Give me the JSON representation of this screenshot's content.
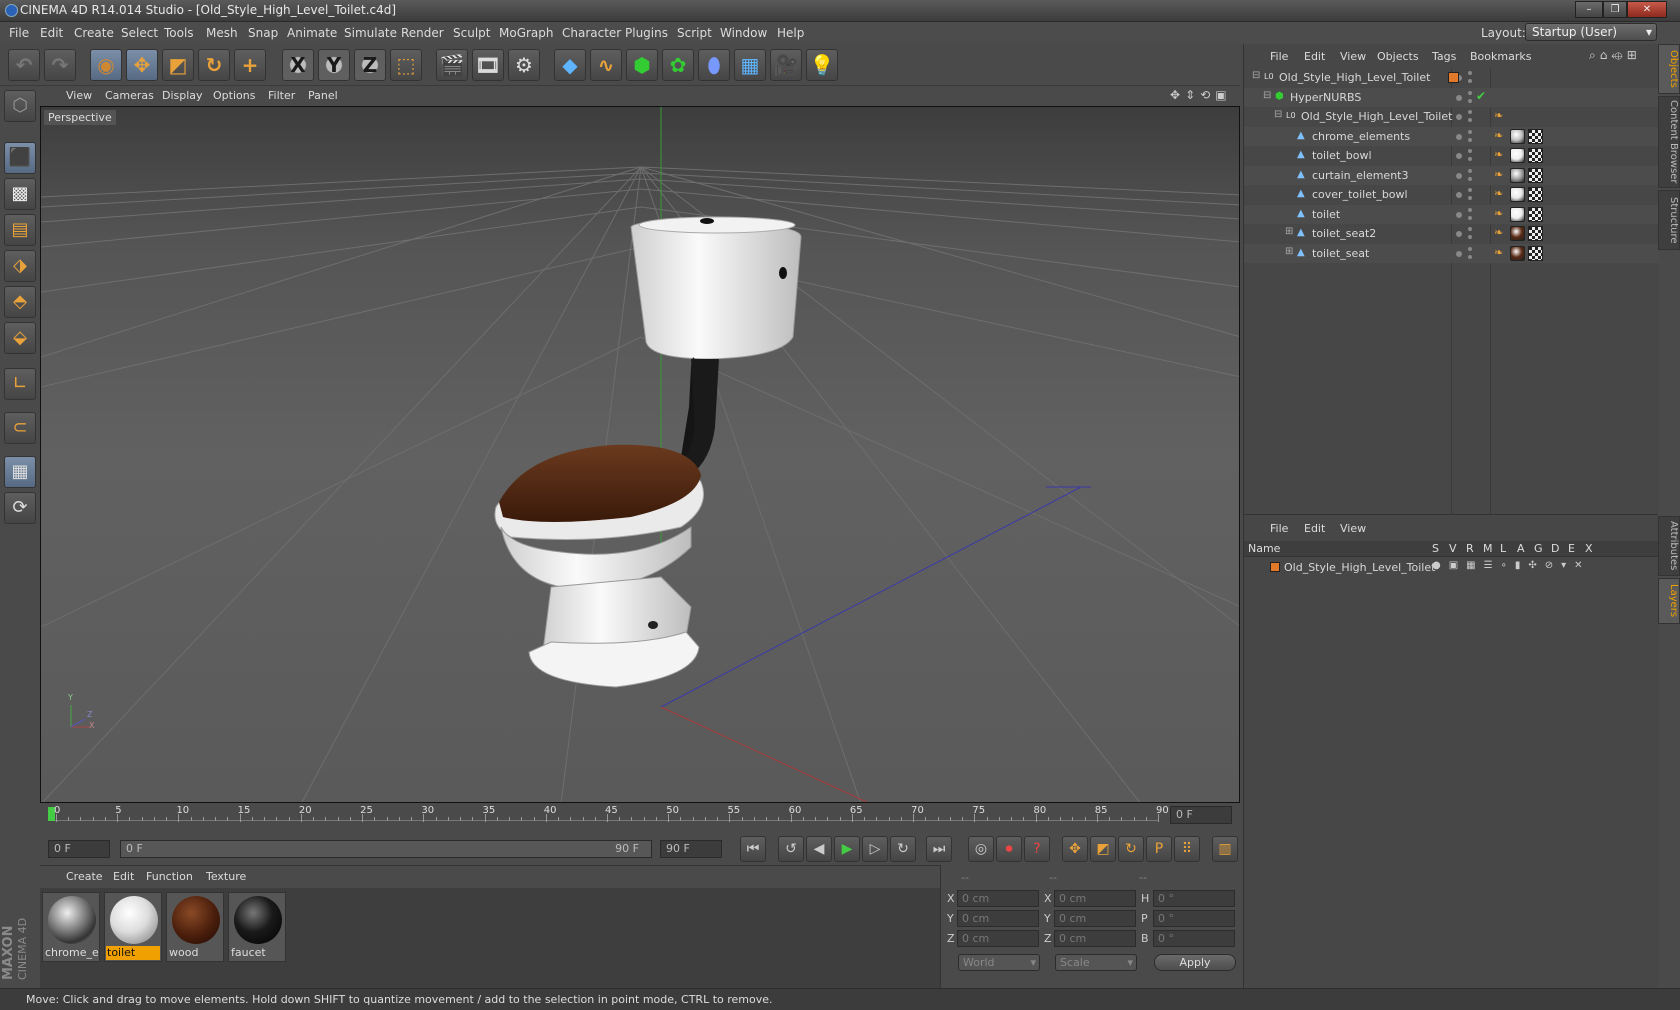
{
  "window": {
    "title": "CINEMA 4D R14.014 Studio - [Old_Style_High_Level_Toilet.c4d]",
    "controls": [
      "–",
      "❐",
      "✕"
    ]
  },
  "menubar": {
    "items": [
      "File",
      "Edit",
      "Create",
      "Select",
      "Tools",
      "Mesh",
      "Snap",
      "Animate",
      "Simulate",
      "Render",
      "Sculpt",
      "MoGraph",
      "Character",
      "Plugins",
      "Script",
      "Window",
      "Help"
    ],
    "layout_label": "Layout:",
    "layout_value": "Startup (User)"
  },
  "toolbar": {
    "icons": [
      "undo-icon",
      "redo-icon",
      "live-selection-icon",
      "move-icon",
      "scale-icon",
      "rotate-icon",
      "add-icon",
      "x-axis-icon",
      "y-axis-icon",
      "z-axis-icon",
      "coordinate-system-icon",
      "render-view-icon",
      "render-picture-viewer-icon",
      "render-settings-icon",
      "cube-primitive-icon",
      "spline-icon",
      "nurbs-icon",
      "array-icon",
      "deformer-icon",
      "floor-icon",
      "camera-icon",
      "light-icon"
    ],
    "axis_labels": [
      "X",
      "Y",
      "Z"
    ]
  },
  "lefttools": {
    "icons": [
      "make-editable-icon",
      "model-mode-icon",
      "texture-mode-icon",
      "workplane-icon",
      "points-mode-icon",
      "edges-mode-icon",
      "polygons-mode-icon",
      "axis-mode-icon",
      "tweak-mode-icon",
      "snap-grid-icon",
      "lock-workplane-icon"
    ]
  },
  "viewport": {
    "menu": [
      "View",
      "Cameras",
      "Display",
      "Options",
      "Filter",
      "Panel"
    ],
    "label": "Perspective",
    "nav_icons": [
      "move-view-icon",
      "zoom-view-icon",
      "rotate-view-icon",
      "maximize-view-icon"
    ],
    "axis_gizmo": {
      "y": "Y",
      "x": "X",
      "z": "Z"
    }
  },
  "timeline": {
    "ticks": [
      "0",
      "5",
      "10",
      "15",
      "20",
      "25",
      "30",
      "35",
      "40",
      "45",
      "50",
      "55",
      "60",
      "65",
      "70",
      "75",
      "80",
      "85",
      "90"
    ],
    "current_frame": "0 F",
    "frame_field": "0 F",
    "range_start": "0 F",
    "range_end": "90 F",
    "end_field": "90 F"
  },
  "materials": {
    "menu": [
      "Create",
      "Edit",
      "Function",
      "Texture"
    ],
    "items": [
      {
        "label": "chrome_ele",
        "color": "#a8a8a8"
      },
      {
        "label": "toilet",
        "color": "#eeeeee"
      },
      {
        "label": "wood",
        "color": "#5a2a14"
      },
      {
        "label": "faucet",
        "color": "#1c1c1c"
      }
    ],
    "selected": "toilet"
  },
  "coords": {
    "headers": [
      "--",
      "--",
      "--"
    ],
    "rows": [
      {
        "a": "X",
        "av": "0 cm",
        "b": "X",
        "bv": "0 cm",
        "c": "H",
        "cv": "0 °"
      },
      {
        "a": "Y",
        "av": "0 cm",
        "b": "Y",
        "bv": "0 cm",
        "c": "P",
        "cv": "0 °"
      },
      {
        "a": "Z",
        "av": "0 cm",
        "b": "Z",
        "bv": "0 cm",
        "c": "B",
        "cv": "0 °"
      }
    ],
    "space": "World",
    "mode": "Scale",
    "apply": "Apply"
  },
  "status": "Move: Click and drag to move elements. Hold down SHIFT to quantize movement / add to the selection in point mode, CTRL to remove.",
  "maxon": {
    "line1": "MAXON",
    "line2": "CINEMA 4D"
  },
  "objects": {
    "menu": [
      "File",
      "Edit",
      "View",
      "Objects",
      "Tags",
      "Bookmarks"
    ],
    "tree": [
      {
        "name": "Old_Style_High_Level_Toilet",
        "indent": 0,
        "icon": "null-icon",
        "tags": "layer"
      },
      {
        "name": "HyperNURBS",
        "indent": 1,
        "icon": "hypernurbs-icon",
        "tags": "check"
      },
      {
        "name": "Old_Style_High_Level_Toilet",
        "indent": 2,
        "icon": "null-icon",
        "tags": "phong"
      },
      {
        "name": "chrome_elements",
        "indent": 3,
        "icon": "polygon-icon",
        "tags": "mat",
        "mat": "#c0c0c0"
      },
      {
        "name": "toilet_bowl",
        "indent": 3,
        "icon": "polygon-icon",
        "tags": "mat",
        "mat": "#eeeeee"
      },
      {
        "name": "curtain_element3",
        "indent": 3,
        "icon": "polygon-icon",
        "tags": "mat",
        "mat": "#a0a0a0"
      },
      {
        "name": "cover_toilet_bowl",
        "indent": 3,
        "icon": "polygon-icon",
        "tags": "mat",
        "mat": "#e6e6e6"
      },
      {
        "name": "toilet",
        "indent": 3,
        "icon": "polygon-icon",
        "tags": "mat",
        "mat": "#eeeeee"
      },
      {
        "name": "toilet_seat2",
        "indent": 3,
        "icon": "polygon-icon",
        "tags": "mat",
        "mat": "#5a2a14"
      },
      {
        "name": "toilet_seat",
        "indent": 3,
        "icon": "polygon-icon",
        "tags": "mat",
        "mat": "#5a2a14"
      }
    ]
  },
  "layers": {
    "menu": [
      "File",
      "Edit",
      "View"
    ],
    "columns": [
      "Name",
      "S",
      "V",
      "R",
      "M",
      "L",
      "A",
      "G",
      "D",
      "E",
      "X"
    ],
    "rows": [
      {
        "name": "Old_Style_High_Level_Toilet",
        "color": "#e07a2a"
      }
    ]
  },
  "sidetabs": {
    "top": [
      "Objects",
      "Content Browser",
      "Structure"
    ],
    "bottom": [
      "Attributes",
      "Layers"
    ]
  },
  "colors": {
    "accent": "#f0a000",
    "object_tag": "#e07a2a",
    "selection": "#7b8fa8"
  }
}
